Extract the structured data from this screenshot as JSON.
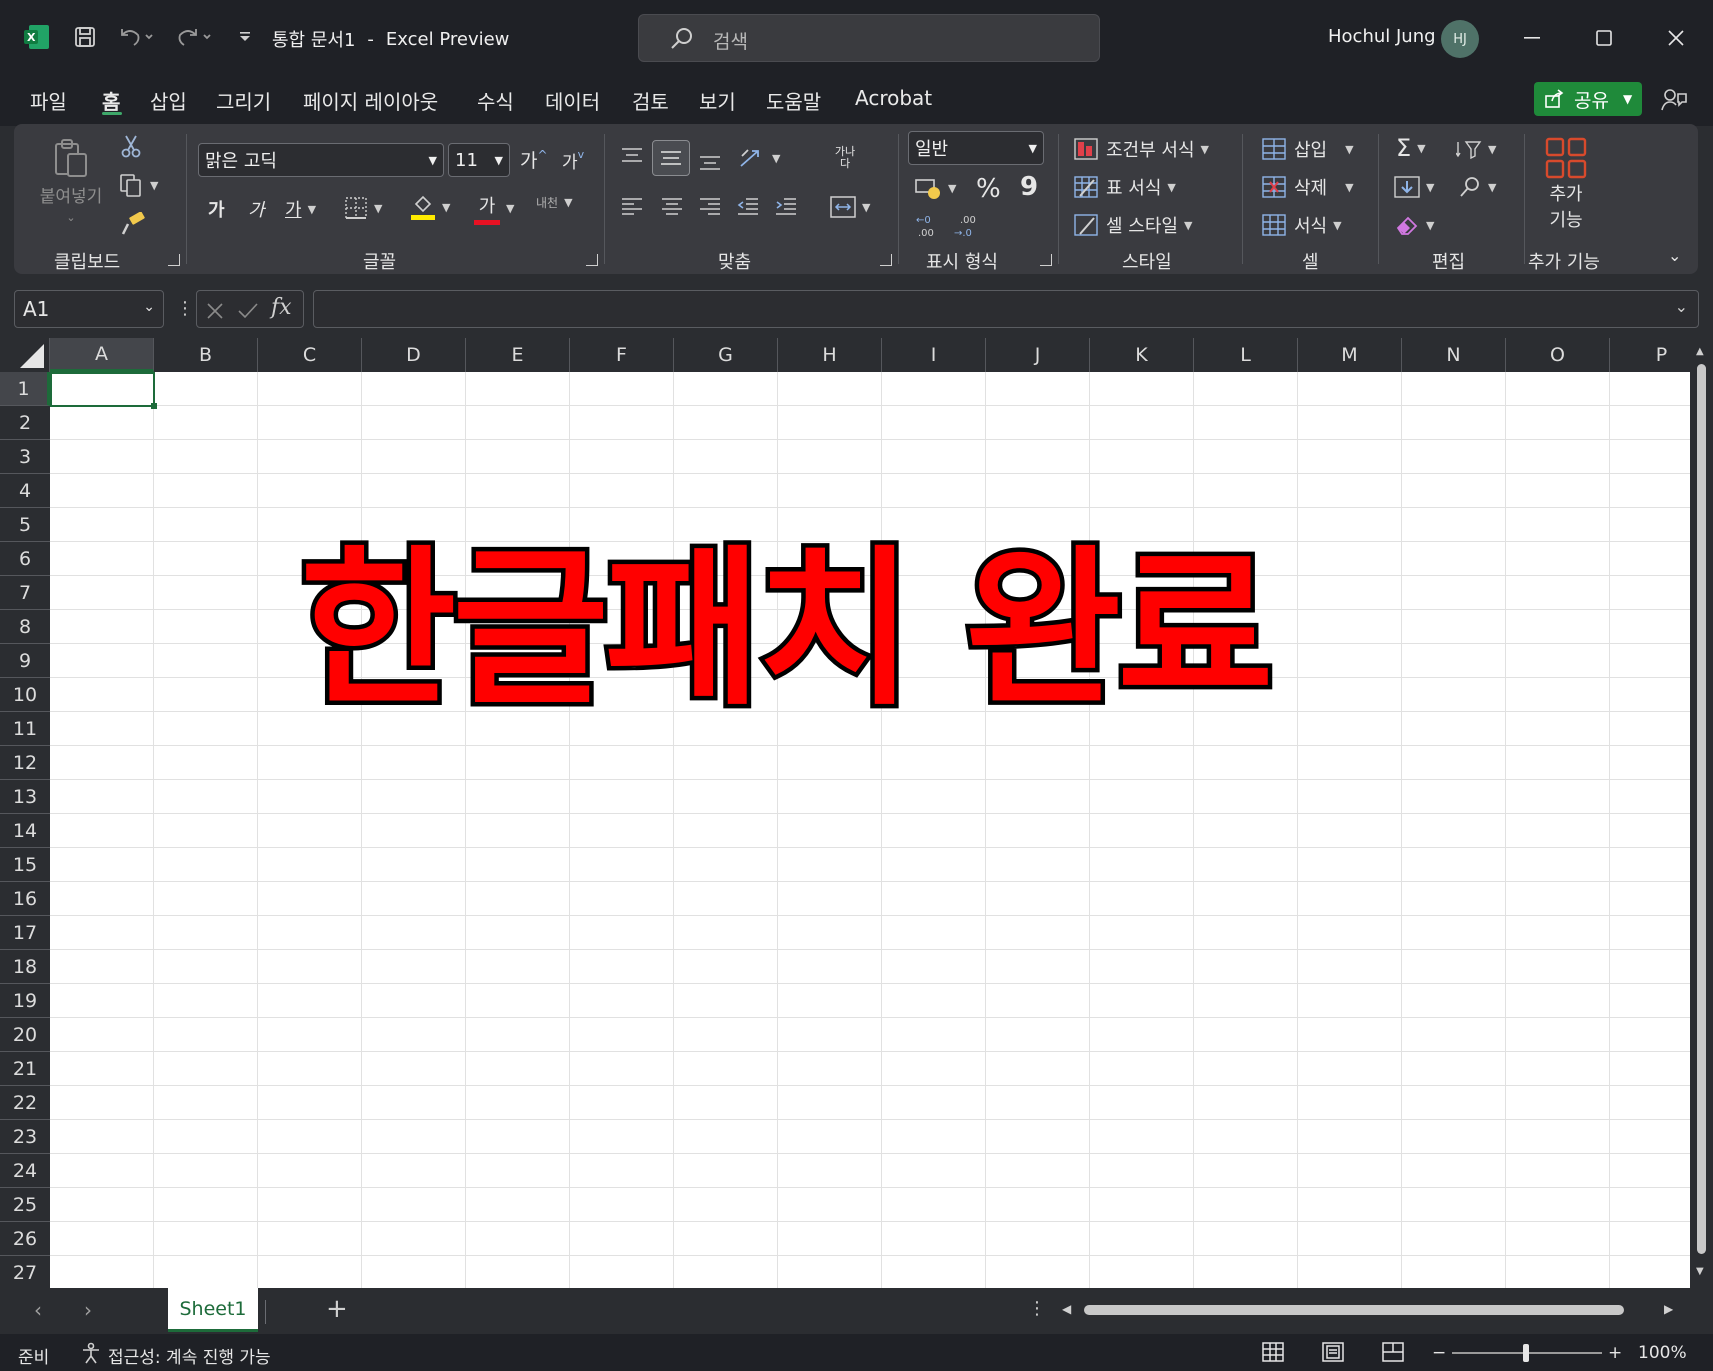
{
  "titlebar": {
    "doc_title": "통합 문서1",
    "app_name": "Excel Preview",
    "separator": "-",
    "search_placeholder": "검색",
    "user_name": "Hochul Jung",
    "user_initials": "HJ"
  },
  "menu": {
    "tabs": [
      "파일",
      "홈",
      "삽입",
      "그리기",
      "페이지 레이아웃",
      "수식",
      "데이터",
      "검토",
      "보기",
      "도움말",
      "Acrobat"
    ],
    "active_tab": "홈",
    "share_label": "공유"
  },
  "ribbon": {
    "clipboard": {
      "label": "클립보드",
      "paste": "붙여넣기"
    },
    "font": {
      "label": "글꼴",
      "font_name": "맑은 고딕",
      "font_size": "11",
      "grow": "가",
      "shrink": "가",
      "bold": "가",
      "italic": "가",
      "underline": "가",
      "font_color": "가",
      "phonetic": "내천"
    },
    "alignment": {
      "label": "맞춤",
      "wrap": "가나다"
    },
    "number": {
      "label": "표시 형식",
      "format": "일반",
      "percent": "%",
      "comma": "9"
    },
    "styles": {
      "label": "스타일",
      "conditional": "조건부 서식",
      "table": "표 서식",
      "cell_style": "셀 스타일"
    },
    "cells": {
      "label": "셀",
      "insert": "삽입",
      "delete": "삭제",
      "format": "서식"
    },
    "editing": {
      "label": "편집"
    },
    "addins": {
      "label": "추가 기능",
      "button_line1": "추가",
      "button_line2": "기능"
    }
  },
  "formula_bar": {
    "name_box": "A1",
    "fx": "fx",
    "value": ""
  },
  "grid": {
    "columns": [
      "A",
      "B",
      "C",
      "D",
      "E",
      "F",
      "G",
      "H",
      "I",
      "J",
      "K",
      "L",
      "M",
      "N",
      "O",
      "P"
    ],
    "rows": [
      "1",
      "2",
      "3",
      "4",
      "5",
      "6",
      "7",
      "8",
      "9",
      "10",
      "11",
      "12",
      "13",
      "14",
      "15",
      "16",
      "17",
      "18",
      "19",
      "20",
      "21",
      "22",
      "23",
      "24",
      "25",
      "26",
      "27"
    ],
    "overlay_text": "한글패치 완료",
    "selected_cell": "A1"
  },
  "sheets": {
    "tabs": [
      "Sheet1"
    ],
    "add_label": "+"
  },
  "status": {
    "ready": "준비",
    "accessibility": "접근성: 계속 진행 가능",
    "zoom": "100%"
  },
  "colors": {
    "accent_green": "#1d6b3a",
    "share_green": "#1f8a3a",
    "overlay_red": "#ff0000",
    "chrome_dark": "#1f2126"
  }
}
